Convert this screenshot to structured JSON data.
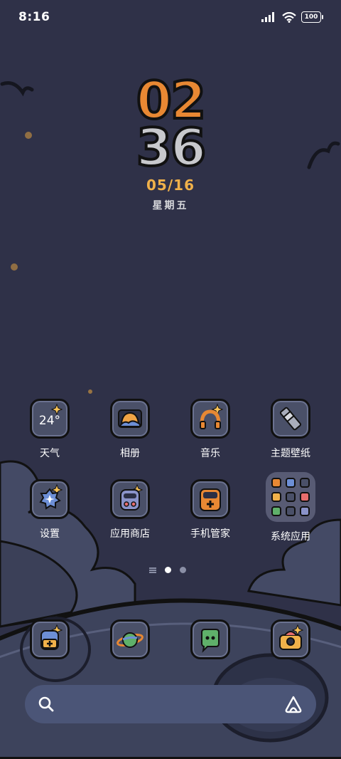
{
  "status_bar": {
    "time": "8:16",
    "battery": "100"
  },
  "clock": {
    "hour": "02",
    "minute": "36",
    "date": "05/16",
    "weekday": "星期五"
  },
  "apps": [
    {
      "label": "天气",
      "icon": "weather-icon",
      "temp": "24°"
    },
    {
      "label": "相册",
      "icon": "gallery-icon"
    },
    {
      "label": "音乐",
      "icon": "music-icon"
    },
    {
      "label": "主题壁纸",
      "icon": "themes-icon"
    },
    {
      "label": "设置",
      "icon": "settings-icon"
    },
    {
      "label": "应用商店",
      "icon": "app-store-icon"
    },
    {
      "label": "手机管家",
      "icon": "security-icon"
    },
    {
      "label": "系统应用",
      "icon": "folder-icon"
    }
  ],
  "dock": [
    {
      "icon": "phone-icon"
    },
    {
      "icon": "browser-icon"
    },
    {
      "icon": "messages-icon"
    },
    {
      "icon": "camera-icon"
    }
  ],
  "colors": {
    "background": "#2f3148",
    "accent_orange": "#e88833",
    "date_yellow": "#f0b14a",
    "search_bar": "#4b5577"
  }
}
